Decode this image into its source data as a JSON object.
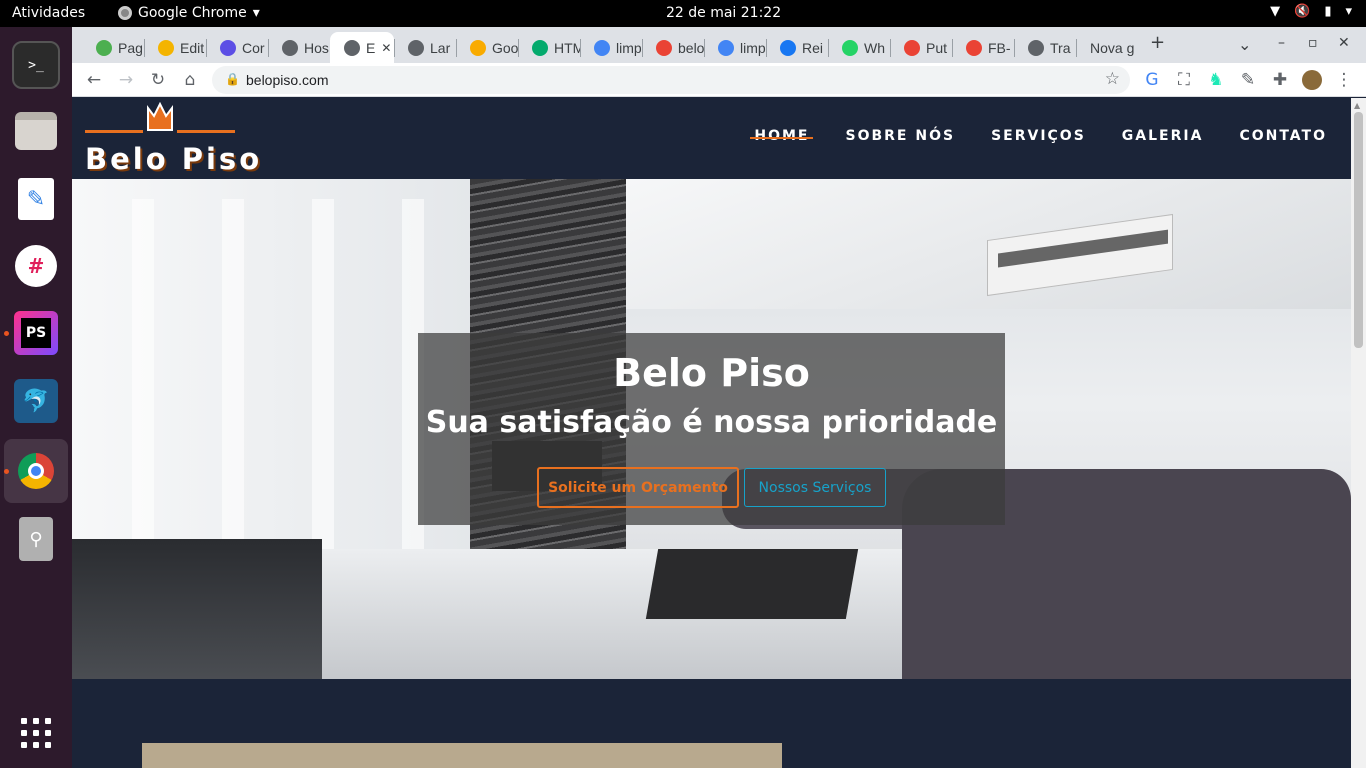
{
  "system": {
    "activities": "Atividades",
    "app_name": "Google Chrome",
    "clock": "22 de mai  21:22"
  },
  "browser": {
    "tabs": [
      {
        "label": "Pag",
        "icon": "code-icon",
        "color": "#4caf50"
      },
      {
        "label": "Edit",
        "icon": "chrome-icon",
        "color": "#f4b400"
      },
      {
        "label": "Cor",
        "icon": "h-icon",
        "color": "#5c4ee5"
      },
      {
        "label": "Hos",
        "icon": "globe-icon",
        "color": "#5f6368"
      },
      {
        "label": "E",
        "icon": "globe-icon",
        "color": "#5f6368",
        "active": true
      },
      {
        "label": "Lar",
        "icon": "globe-icon",
        "color": "#5f6368"
      },
      {
        "label": "Goo",
        "icon": "analytics-icon",
        "color": "#f9ab00"
      },
      {
        "label": "HTM",
        "icon": "w3-icon",
        "color": "#04aa6d"
      },
      {
        "label": "limp",
        "icon": "google-icon",
        "color": "#4285f4"
      },
      {
        "label": "belo",
        "icon": "maps-icon",
        "color": "#ea4335"
      },
      {
        "label": "limp",
        "icon": "google-icon",
        "color": "#4285f4"
      },
      {
        "label": "Rei",
        "icon": "facebook-icon",
        "color": "#1877f2"
      },
      {
        "label": "Wh",
        "icon": "whatsapp-icon",
        "color": "#25d366"
      },
      {
        "label": "Put",
        "icon": "gmail-icon",
        "color": "#ea4335"
      },
      {
        "label": "FB-",
        "icon": "gmail-icon",
        "color": "#ea4335"
      },
      {
        "label": "Tra",
        "icon": "globe-icon",
        "color": "#5f6368"
      },
      {
        "label": "Nova g",
        "icon": "",
        "color": "#5f6368"
      }
    ],
    "new_tab": "+",
    "url": "belopiso.com"
  },
  "site": {
    "logo_text": "Belo Piso",
    "nav": [
      {
        "label": "HOME",
        "active": true
      },
      {
        "label": "SOBRE NÓS"
      },
      {
        "label": "SERVIÇOS"
      },
      {
        "label": "GALERIA"
      },
      {
        "label": "CONTATO"
      }
    ],
    "hero": {
      "title": "Belo Piso",
      "subtitle": "Sua satisfação é nossa prioridade",
      "cta_primary": "Solicite um Orçamento",
      "cta_secondary": "Nossos Serviços"
    },
    "colors": {
      "navy": "#1b2438",
      "accent_orange": "#e8701f",
      "accent_cyan": "#17a2c9"
    }
  }
}
